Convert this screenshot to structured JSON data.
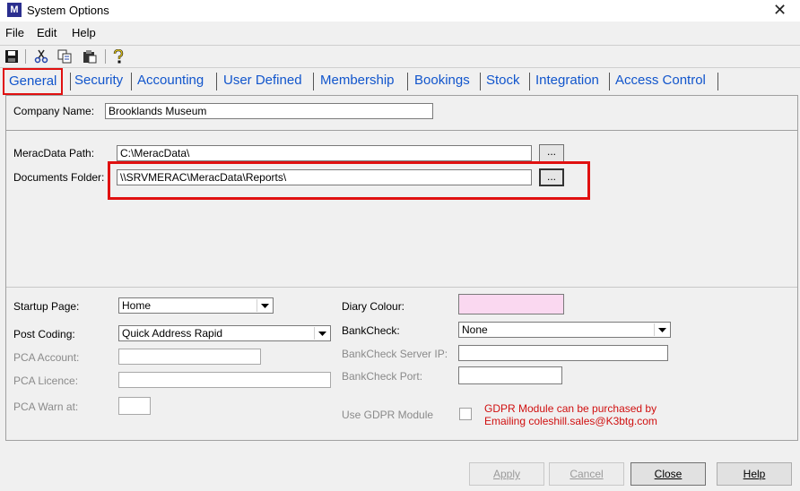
{
  "window": {
    "title": "System Options",
    "icon_text": "M",
    "close_glyph": "✕"
  },
  "menu": [
    "File",
    "Edit",
    "Help"
  ],
  "toolbar": {
    "icons": [
      "save-icon",
      "cut-icon",
      "copy-icon",
      "paste-icon",
      "help-icon"
    ]
  },
  "tabs": [
    "General",
    "Security",
    "Accounting",
    "User Defined",
    "Membership",
    "Bookings",
    "Stock",
    "Integration",
    "Access Control"
  ],
  "active_tab": "General",
  "general": {
    "company_name_label": "Company Name:",
    "company_name_value": "Brooklands Museum",
    "meracdata_path_label": "MeracData Path:",
    "meracdata_path_value": "C:\\MeracData\\",
    "documents_folder_label": "Documents Folder:",
    "documents_folder_value": "\\\\SRVMERAC\\MeracData\\Reports\\",
    "browse_label": "...",
    "startup_page_label": "Startup Page:",
    "startup_page_value": "Home",
    "post_coding_label": "Post Coding:",
    "post_coding_value": "Quick Address Rapid",
    "pca_account_label": "PCA Account:",
    "pca_account_value": "",
    "pca_licence_label": "PCA Licence:",
    "pca_licence_value": "",
    "pca_warn_label": "PCA Warn at:",
    "pca_warn_value": "",
    "diary_colour_label": "Diary Colour:",
    "diary_colour_hex": "#fad8f0",
    "bankcheck_label": "BankCheck:",
    "bankcheck_value": "None",
    "bankcheck_server_label": "BankCheck Server IP:",
    "bankcheck_server_value": "",
    "bankcheck_port_label": "BankCheck Port:",
    "bankcheck_port_value": "",
    "gdpr_label": "Use GDPR Module",
    "gdpr_note_line1": "GDPR Module can be purchased by",
    "gdpr_note_line2": "Emailing coleshill.sales@K3btg.com"
  },
  "buttons": {
    "apply": "Apply",
    "cancel": "Cancel",
    "close": "Close",
    "help": "Help"
  },
  "colors": {
    "highlight": "#e01010",
    "tab_text": "#1155cc",
    "gdpr_note": "#d01010"
  }
}
